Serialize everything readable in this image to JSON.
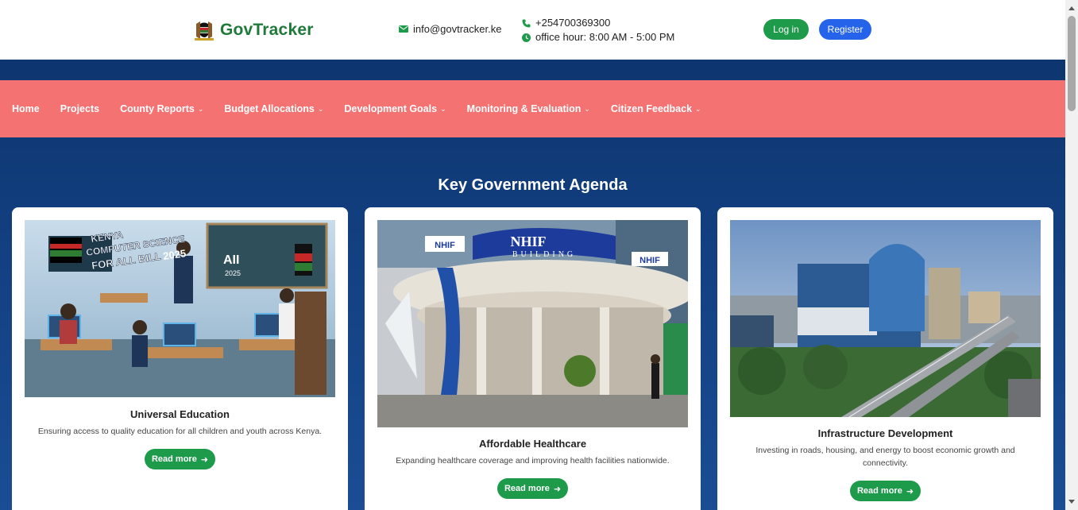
{
  "header": {
    "logo_text": "GovTracker",
    "email": "info@govtracker.ke",
    "phone": "+254700369300",
    "hours": "office hour: 8:00 AM - 5:00 PM",
    "login_label": "Log in",
    "register_label": "Register"
  },
  "nav": {
    "items": [
      {
        "label": "Home",
        "dropdown": false
      },
      {
        "label": "Projects",
        "dropdown": false
      },
      {
        "label": "County Reports",
        "dropdown": true
      },
      {
        "label": "Budget Allocations",
        "dropdown": true
      },
      {
        "label": "Development Goals",
        "dropdown": true
      },
      {
        "label": "Monitoring & Evaluation",
        "dropdown": true
      },
      {
        "label": "Citizen Feedback",
        "dropdown": true
      }
    ]
  },
  "main": {
    "section_title": "Key Government Agenda",
    "cards": [
      {
        "title": "Universal Education",
        "description": "Ensuring access to quality education for all children and youth across Kenya.",
        "cta": "Read more",
        "image_text": "KENYA COMPUTER SCIENCE FOR ALL BILL 2025"
      },
      {
        "title": "Affordable Healthcare",
        "description": "Expanding healthcare coverage and improving health facilities nationwide.",
        "cta": "Read more",
        "image_text": "NHIF BUILDING"
      },
      {
        "title": "Infrastructure Development",
        "description": "Investing in roads, housing, and energy to boost economic growth and connectivity.",
        "cta": "Read more"
      }
    ]
  },
  "colors": {
    "brand_green": "#1e9a4b",
    "register_blue": "#2563eb",
    "nav_coral": "#f47272",
    "hero_blue": "#0f3a7a"
  }
}
